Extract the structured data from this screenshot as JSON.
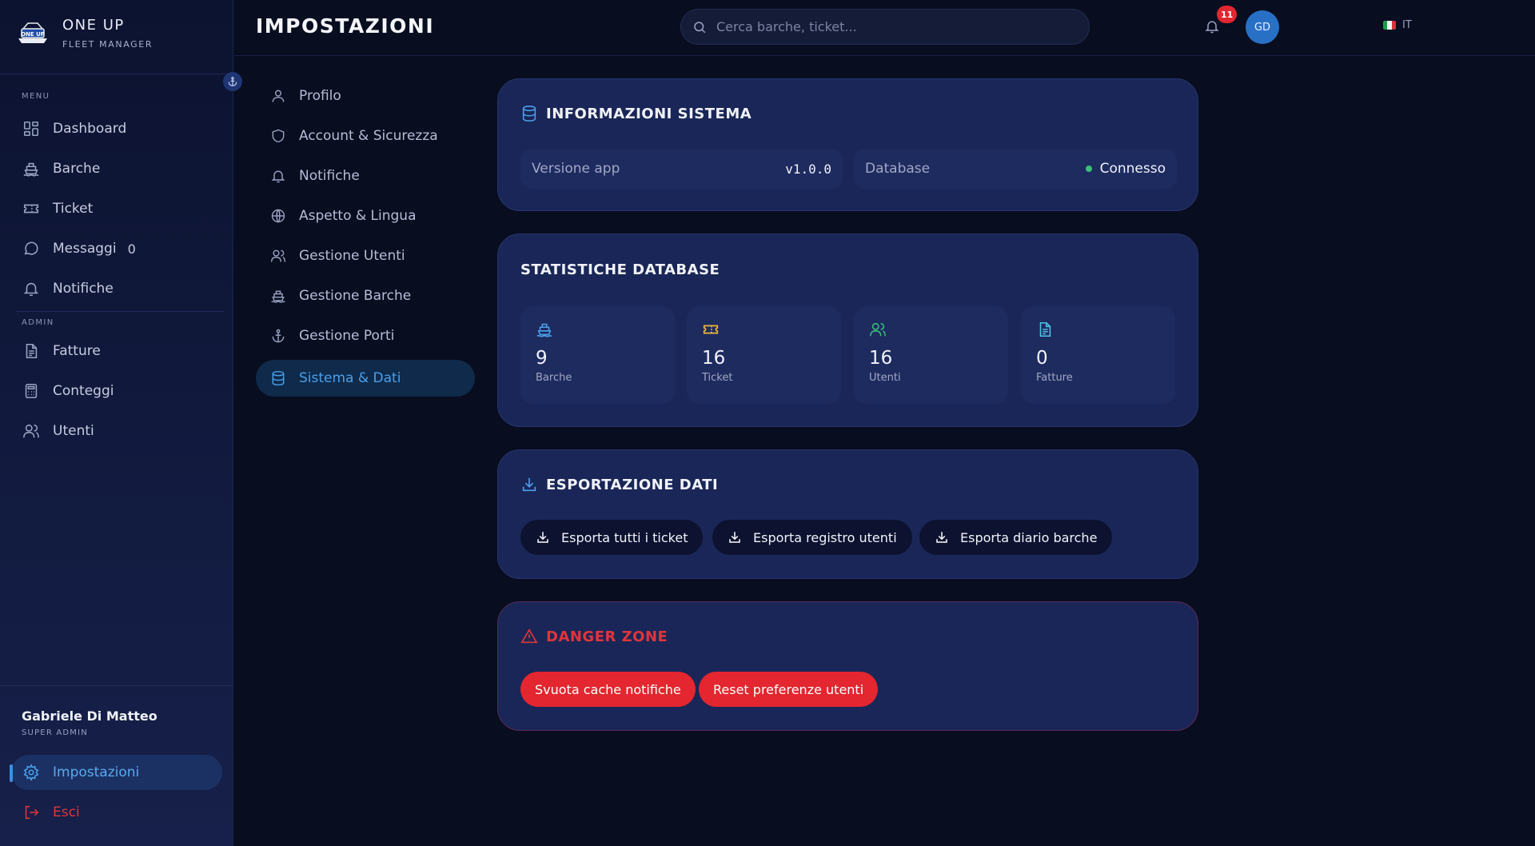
{
  "brand": {
    "name": "ONE UP",
    "subtitle": "FLEET MANAGER"
  },
  "sidebar": {
    "menu_label": "MENU",
    "items": [
      {
        "label": "Dashboard",
        "icon": "dashboard-icon"
      },
      {
        "label": "Barche",
        "icon": "ship-icon"
      },
      {
        "label": "Ticket",
        "icon": "ticket-icon"
      },
      {
        "label": "Messaggi",
        "icon": "message-icon",
        "badge": "0"
      },
      {
        "label": "Notifiche",
        "icon": "bell-icon"
      }
    ],
    "admin_label": "ADMIN",
    "admin_items": [
      {
        "label": "Fatture",
        "icon": "invoice-icon"
      },
      {
        "label": "Conteggi",
        "icon": "calculator-icon"
      },
      {
        "label": "Utenti",
        "icon": "users-icon"
      }
    ],
    "user": {
      "name": "Gabriele Di Matteo",
      "role": "SUPER ADMIN"
    },
    "settings_label": "Impostazioni",
    "logout_label": "Esci"
  },
  "header": {
    "title": "IMPOSTAZIONI",
    "search_placeholder": "Cerca barche, ticket...",
    "language": "IT",
    "notifications_count": "11",
    "avatar_initials": "GD"
  },
  "settings_nav": {
    "items": [
      {
        "label": "Profilo",
        "icon": "user-icon"
      },
      {
        "label": "Account & Sicurezza",
        "icon": "shield-icon"
      },
      {
        "label": "Notifiche",
        "icon": "bell-icon"
      },
      {
        "label": "Aspetto & Lingua",
        "icon": "globe-icon"
      },
      {
        "label": "Gestione Utenti",
        "icon": "users-icon"
      },
      {
        "label": "Gestione Barche",
        "icon": "ship-icon"
      },
      {
        "label": "Gestione Porti",
        "icon": "anchor-icon"
      },
      {
        "label": "Sistema & Dati",
        "icon": "database-icon",
        "active": true
      }
    ]
  },
  "system_info": {
    "title": "INFORMAZIONI SISTEMA",
    "app_version_label": "Versione app",
    "app_version_value": "v1.0.0",
    "database_label": "Database",
    "database_status": "Connesso"
  },
  "db_stats": {
    "title": "STATISTICHE DATABASE",
    "items": [
      {
        "value": "9",
        "label": "Barche",
        "icon": "ship-icon",
        "color": "#4aa0ec"
      },
      {
        "value": "16",
        "label": "Ticket",
        "icon": "ticket-icon",
        "color": "#e8b53a"
      },
      {
        "value": "16",
        "label": "Utenti",
        "icon": "users-icon",
        "color": "#3bc07a"
      },
      {
        "value": "0",
        "label": "Fatture",
        "icon": "invoice-icon",
        "color": "#4fc3e8"
      }
    ]
  },
  "export": {
    "title": "ESPORTAZIONE DATI",
    "buttons": [
      "Esporta tutti i ticket",
      "Esporta registro utenti",
      "Esporta diario barche"
    ]
  },
  "danger_zone": {
    "title": "DANGER ZONE",
    "buttons": [
      "Svuota cache notifiche",
      "Reset preferenze utenti"
    ]
  },
  "colors": {
    "accent": "#4aa0ec",
    "danger": "#e3262f",
    "success": "#3bc07a"
  }
}
